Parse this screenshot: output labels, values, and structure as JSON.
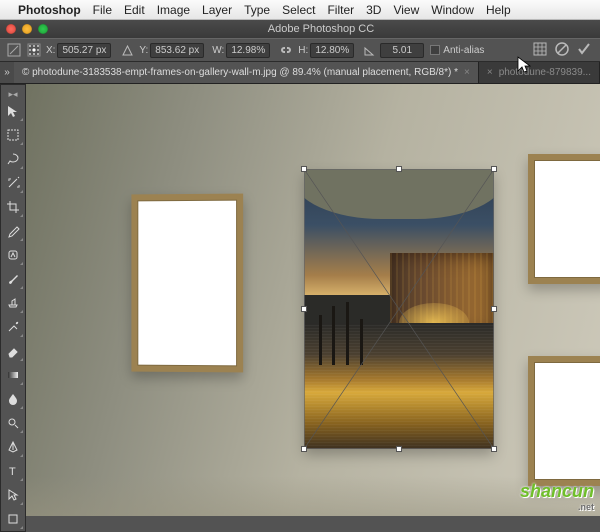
{
  "menubar": {
    "app": "Photoshop",
    "items": [
      "File",
      "Edit",
      "Image",
      "Layer",
      "Type",
      "Select",
      "Filter",
      "3D",
      "View",
      "Window",
      "Help"
    ]
  },
  "window": {
    "title": "Adobe Photoshop CC"
  },
  "options": {
    "x_label": "X:",
    "x_value": "505.27 px",
    "y_label": "Y:",
    "y_value": "853.62 px",
    "w_label": "W:",
    "w_value": "12.98%",
    "h_label": "H:",
    "h_value": "12.80%",
    "angle_value": "5.01",
    "antialias_label": "Anti-alias"
  },
  "tabs": {
    "active": "© photodune-3183538-empt-frames-on-gallery-wall-m.jpg @ 89.4% (manual placement, RGB/8*) *",
    "inactive": "photodune-879839..."
  },
  "tools": {
    "names": [
      "move",
      "marquee",
      "lasso",
      "magic-wand",
      "crop",
      "eyedropper",
      "healing-brush",
      "brush",
      "clone-stamp",
      "history-brush",
      "eraser",
      "gradient",
      "blur",
      "dodge",
      "pen",
      "type",
      "path-select",
      "rectangle"
    ]
  },
  "watermark": {
    "text": "shancun",
    "sub": ".net"
  }
}
